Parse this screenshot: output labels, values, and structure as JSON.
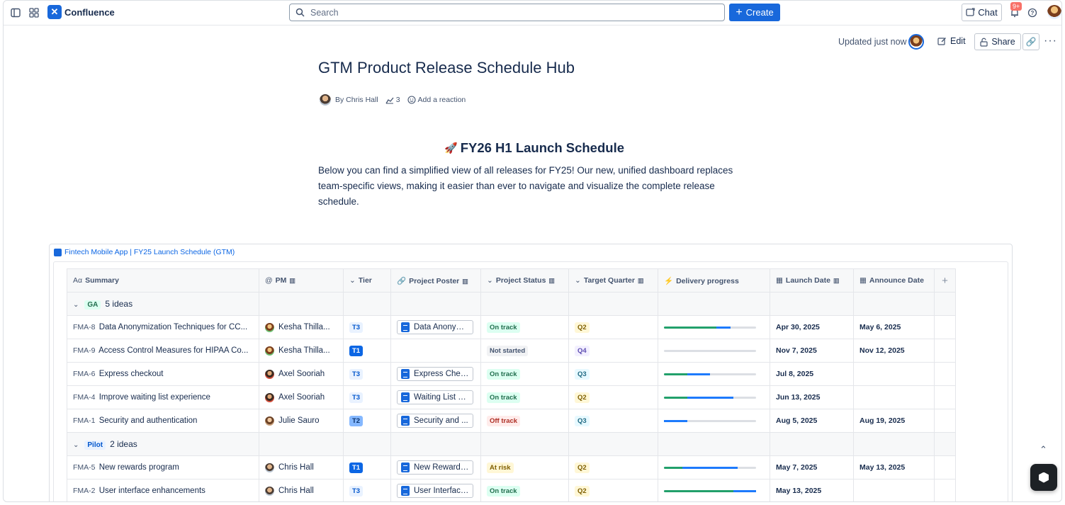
{
  "topbar": {
    "brand": "Confluence",
    "search_placeholder": "Search",
    "create_label": "Create",
    "chat_label": "Chat",
    "notif_count": "9+"
  },
  "page": {
    "updated": "Updated just now",
    "edit_label": "Edit",
    "share_label": "Share",
    "title": "GTM Product Release Schedule Hub",
    "byline_author": "By Chris Hall",
    "byline_views": "3",
    "byline_reaction": "Add a reaction",
    "heading_emoji": "🚀",
    "heading": "FY26 H1 Launch Schedule",
    "paragraph": "Below you can find a simplified view of all releases for FY25! Our new, unified dashboard replaces team-specific views, making it easier than ever to navigate and visualize the complete release schedule."
  },
  "embed": {
    "link": "Fintech Mobile App | FY25 Launch Schedule (GTM)",
    "columns": [
      "Summary",
      "PM",
      "Tier",
      "Project Poster",
      "Project Status",
      "Target Quarter",
      "Delivery progress",
      "Launch Date",
      "Announce Date"
    ],
    "groups": [
      {
        "label": "GA",
        "count": "5 ideas",
        "rows": [
          {
            "key": "FMA-8",
            "summary": "Data Anonymization Techniques for CC...",
            "pm": "Kesha Thilla...",
            "tier": "T3",
            "poster": "Data Anonymi...",
            "status": "On track",
            "quarter": "Q2",
            "progress": {
              "green": 0.57,
              "blue": 0.15
            },
            "launch": "Apr 30, 2025",
            "announce": "May 6, 2025"
          },
          {
            "key": "FMA-9",
            "summary": "Access Control Measures for HIPAA Co...",
            "pm": "Kesha Thilla...",
            "tier": "T1",
            "poster": "",
            "status": "Not started",
            "quarter": "Q4",
            "progress": {
              "green": 0,
              "blue": 0
            },
            "launch": "Nov 7, 2025",
            "announce": "Nov 12, 2025"
          },
          {
            "key": "FMA-6",
            "summary": "Express checkout",
            "pm": "Axel Sooriah",
            "tier": "T3",
            "poster": "Express Chec...",
            "status": "On track",
            "quarter": "Q3",
            "progress": {
              "green": 0.25,
              "blue": 0.25
            },
            "launch": "Jul 8, 2025",
            "announce": ""
          },
          {
            "key": "FMA-4",
            "summary": "Improve waiting list experience",
            "pm": "Axel Sooriah",
            "tier": "T3",
            "poster": "Waiting List R...",
            "status": "On track",
            "quarter": "Q2",
            "progress": {
              "green": 0.25,
              "blue": 0.5
            },
            "launch": "Jun 13, 2025",
            "announce": ""
          },
          {
            "key": "FMA-1",
            "summary": "Security and authentication",
            "pm": "Julie Sauro",
            "tier": "T2",
            "poster": "Security and ...",
            "status": "Off track",
            "quarter": "Q3",
            "progress": {
              "green": 0,
              "blue": 0.25
            },
            "launch": "Aug 5, 2025",
            "announce": "Aug 19, 2025"
          }
        ]
      },
      {
        "label": "Pilot",
        "count": "2 ideas",
        "rows": [
          {
            "key": "FMA-5",
            "summary": "New rewards program",
            "pm": "Chris Hall",
            "tier": "T1",
            "poster": "New Rewards ...",
            "status": "At risk",
            "quarter": "Q2",
            "progress": {
              "green": 0.2,
              "blue": 0.6
            },
            "launch": "May 7, 2025",
            "announce": "May 13, 2025"
          },
          {
            "key": "FMA-2",
            "summary": "User interface enhancements",
            "pm": "Chris Hall",
            "tier": "T3",
            "poster": "User Interface...",
            "status": "On track",
            "quarter": "Q2",
            "progress": {
              "green": 0.75,
              "blue": 0.25
            },
            "launch": "May 13, 2025",
            "announce": ""
          }
        ]
      }
    ]
  }
}
